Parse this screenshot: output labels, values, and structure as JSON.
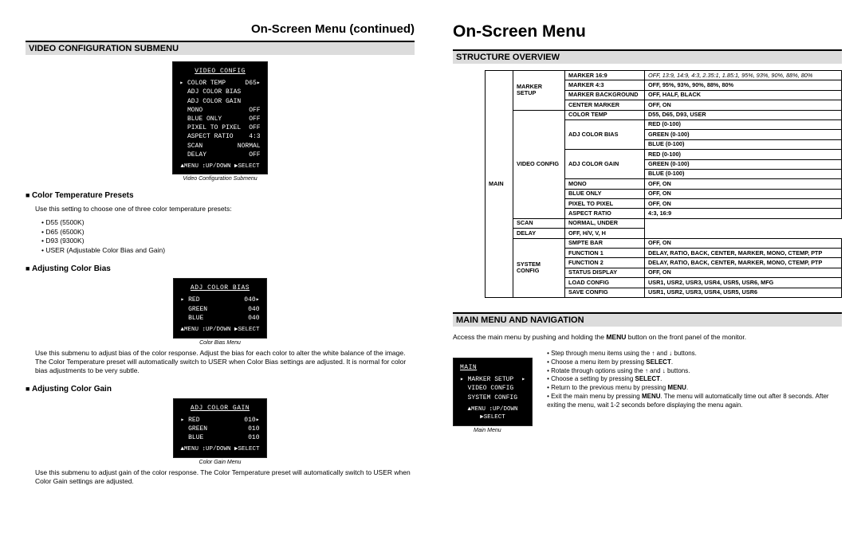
{
  "left": {
    "page_title": "On-Screen Menu (continued)",
    "section_bar": "VIDEO CONFIGURATION SUBMENU",
    "osd1": {
      "title": "VIDEO CONFIG",
      "rows": [
        {
          "lab": "▸ COLOR TEMP",
          "val": "D65▸"
        },
        {
          "lab": "  ADJ COLOR BIAS",
          "val": ""
        },
        {
          "lab": "  ADJ COLOR GAIN",
          "val": ""
        },
        {
          "lab": "  MONO",
          "val": "OFF"
        },
        {
          "lab": "  BLUE ONLY",
          "val": "OFF"
        },
        {
          "lab": "  PIXEL TO PIXEL",
          "val": "OFF"
        },
        {
          "lab": "  ASPECT RATIO",
          "val": "4:3"
        },
        {
          "lab": "  SCAN",
          "val": "NORMAL"
        },
        {
          "lab": "  DELAY",
          "val": "OFF"
        }
      ],
      "foot": "▲MENU ↕UP/DOWN ▶SELECT",
      "caption": "Video Configuration Submenu"
    },
    "h1": "Color Temperature Presets",
    "p1": "Use this setting to choose one of three color temperature presets:",
    "presets": [
      "D55 (5500K)",
      "D65 (6500K)",
      "D93 (9300K)",
      "USER (Adjustable Color Bias and Gain)"
    ],
    "h2": "Adjusting Color Bias",
    "osd2": {
      "title": "ADJ COLOR BIAS",
      "rows": [
        {
          "lab": "▸ RED",
          "val": "040▸"
        },
        {
          "lab": "  GREEN",
          "val": "040"
        },
        {
          "lab": "  BLUE",
          "val": "040"
        }
      ],
      "foot": "▲MENU ↕UP/DOWN ▶SELECT",
      "caption": "Color Bias Menu"
    },
    "p2": "Use this submenu to adjust bias of the color response. Adjust the bias for each color to alter the white balance of the image. The Color Temperature preset will automatically switch to USER when Color Bias settings are adjusted. It is normal for color bias adjustments to be very subtle.",
    "h3": "Adjusting Color Gain",
    "osd3": {
      "title": "ADJ COLOR GAIN",
      "rows": [
        {
          "lab": "▸ RED",
          "val": "010▸"
        },
        {
          "lab": "  GREEN",
          "val": "010"
        },
        {
          "lab": "  BLUE",
          "val": "010"
        }
      ],
      "foot": "▲MENU ↕UP/DOWN ▶SELECT",
      "caption": "Color Gain Menu"
    },
    "p3": "Use this submenu to adjust gain of the color response. The Color Temperature preset will automatically switch to USER when Color Gain settings are adjusted."
  },
  "right": {
    "page_title": "On-Screen Menu",
    "section_bar1": "STRUCTURE OVERVIEW",
    "struct_rows": [
      {
        "c1": "",
        "c2": "",
        "c3": "MARKER 16:9",
        "c4": "OFF, 13:9, 14:9, 4:3, 2.35:1, 1.85:1, 95%, 93%, 90%, 88%, 80%",
        "r1": 16,
        "r2": 4
      },
      {
        "c3": "MARKER 4:3",
        "c4": "OFF, 95%, 93%, 90%, 88%, 80%"
      },
      {
        "c3": "MARKER BACKGROUND",
        "c4": "OFF, HALF, BLACK"
      },
      {
        "c3": "CENTER MARKER",
        "c4": "OFF, ON"
      },
      {
        "c2": "",
        "c3": "COLOR TEMP",
        "c4": "D55, D65, D93, USER",
        "r2": 11
      },
      {
        "c3": "ADJ COLOR BIAS",
        "c4": "RED (0-100)",
        "r3": 3
      },
      {
        "c4": "GREEN (0-100)"
      },
      {
        "c4": "BLUE (0-100)"
      },
      {
        "c3": "ADJ COLOR GAIN",
        "c4": "RED (0-100)",
        "r3": 3
      },
      {
        "c4": "GREEN (0-100)"
      },
      {
        "c4": "BLUE (0-100)"
      },
      {
        "c3": "MONO",
        "c4": "OFF, ON"
      },
      {
        "c3": "BLUE ONLY",
        "c4": "OFF, ON"
      },
      {
        "c3": "PIXEL TO PIXEL",
        "c4": "OFF, ON"
      },
      {
        "c3": "ASPECT RATIO",
        "c4": "4:3, 16:9"
      },
      {
        "c3": "SCAN",
        "c4": "NORMAL, UNDER"
      },
      {
        "c3": "DELAY",
        "c4": "OFF, H/V, V, H"
      },
      {
        "c2": "",
        "c3": "SMPTE BAR",
        "c4": "OFF, ON",
        "r2": 6,
        "r1": 0
      },
      {
        "c3": "FUNCTION 1",
        "c4": "DELAY, RATIO, BACK, CENTER, MARKER, MONO, CTEMP, PTP"
      },
      {
        "c3": "FUNCTION 2",
        "c4": "DELAY, RATIO, BACK, CENTER, MARKER, MONO, CTEMP, PTP"
      },
      {
        "c3": "STATUS DISPLAY",
        "c4": "OFF, ON"
      },
      {
        "c3": "LOAD CONFIG",
        "c4": "USR1, USR2, USR3, USR4, USR5, USR6, MFG"
      },
      {
        "c3": "SAVE CONFIG",
        "c4": "USR1, USR2, USR3, USR4, USR5, USR6"
      }
    ],
    "c1_label": "MAIN",
    "c2_labels": [
      "MARKER SETUP",
      "VIDEO CONFIG",
      "SYSTEM CONFIG"
    ],
    "section_bar2": "MAIN MENU AND NAVIGATION",
    "nav_intro_p1": "Access the main menu by pushing and holding the ",
    "nav_intro_b": "MENU",
    "nav_intro_p2": " button on the front panel of the monitor.",
    "osd_main": {
      "title": "MAIN",
      "rows": [
        {
          "lab": "▸ MARKER SETUP",
          "val": "▸"
        },
        {
          "lab": "  VIDEO CONFIG",
          "val": ""
        },
        {
          "lab": "  SYSTEM CONFIG",
          "val": ""
        }
      ],
      "foot": "▲MENU ↕UP/DOWN ▶SELECT",
      "caption": "Main Menu"
    },
    "nav_items": [
      "Step through menu items using the ↑ and ↓ buttons.",
      "Choose a menu item by pressing <b>SELECT</b>.",
      "Rotate through options using the ↑ and ↓ buttons.",
      "Choose a setting by pressing <b>SELECT</b>.",
      "Return to the previous menu by pressing <b>MENU</b>.",
      "Exit the main menu by pressing <b>MENU</b>. The menu will automatically time out after 8 seconds. After exiting the menu, wait 1-2 seconds before displaying the menu again."
    ]
  }
}
